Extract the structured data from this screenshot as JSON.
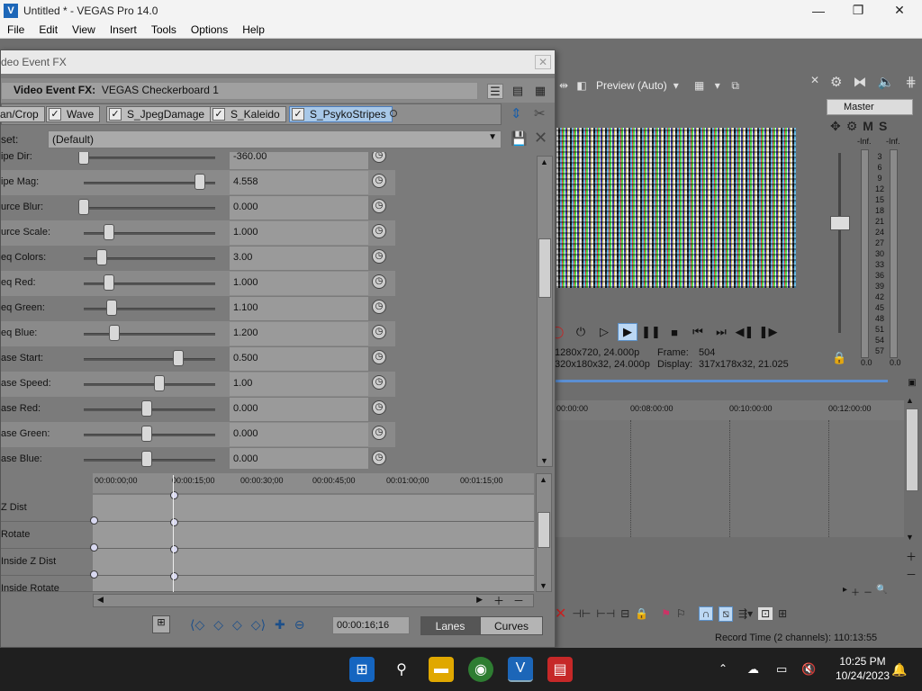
{
  "window": {
    "title": "Untitled * - VEGAS Pro 14.0",
    "logo": "V",
    "minimize": "—",
    "maximize": "❐",
    "close": "✕"
  },
  "menu": [
    "File",
    "Edit",
    "View",
    "Insert",
    "Tools",
    "Options",
    "Help"
  ],
  "fx": {
    "title": "deo Event FX",
    "header_prefix": "Video Event FX:",
    "header_name": "VEGAS Checkerboard 1",
    "chain": [
      {
        "label": "an/Crop",
        "checked": false,
        "active": false
      },
      {
        "label": "Wave",
        "checked": true,
        "active": false
      },
      {
        "label": "S_JpegDamage",
        "checked": true,
        "active": false
      },
      {
        "label": "S_Kaleido",
        "checked": true,
        "active": false
      },
      {
        "label": "S_PsykoStripes",
        "checked": true,
        "active": true
      }
    ],
    "preset_label": "set:",
    "preset_value": "(Default)",
    "params": [
      {
        "name": "ipe Dir:",
        "value": "-360.00",
        "pos": 0.0
      },
      {
        "name": "ipe Mag:",
        "value": "4.558",
        "pos": 0.92
      },
      {
        "name": "urce Blur:",
        "value": "0.000",
        "pos": 0.0
      },
      {
        "name": "urce Scale:",
        "value": "1.000",
        "pos": 0.2
      },
      {
        "name": "eq Colors:",
        "value": "3.00",
        "pos": 0.14
      },
      {
        "name": "eq Red:",
        "value": "1.000",
        "pos": 0.2
      },
      {
        "name": "eq Green:",
        "value": "1.100",
        "pos": 0.22
      },
      {
        "name": "eq Blue:",
        "value": "1.200",
        "pos": 0.24
      },
      {
        "name": "ase Start:",
        "value": "0.500",
        "pos": 0.75
      },
      {
        "name": "ase Speed:",
        "value": "1.00",
        "pos": 0.6
      },
      {
        "name": "ase Red:",
        "value": "0.000",
        "pos": 0.5
      },
      {
        "name": "ase Green:",
        "value": "0.000",
        "pos": 0.5
      },
      {
        "name": "ase Blue:",
        "value": "0.000",
        "pos": 0.5
      }
    ],
    "kf_ruler": [
      "00:00:00;00",
      "00:00:15;00",
      "00:00:30;00",
      "00:00:45;00",
      "00:01:00;00",
      "00:01:15;00"
    ],
    "kf_rows": [
      "Z Dist",
      "Rotate",
      "Inside Z Dist",
      "Inside Rotate"
    ],
    "timecode": "00:00:16;16",
    "lanes_label": "Lanes",
    "curves_label": "Curves"
  },
  "preview": {
    "mode": "Preview (Auto)",
    "project_line": "1280x720, 24.000p",
    "preview_line": "320x180x32, 24.000p",
    "frame_label": "Frame:",
    "frame_value": "504",
    "display_label": "Display:",
    "display_value": "317x178x32, 21.025"
  },
  "master": {
    "label": "Master",
    "m": "M",
    "s": "S",
    "inf_l": "-Inf.",
    "inf_r": "-Inf.",
    "scale": [
      "3",
      "6",
      "9",
      "12",
      "15",
      "18",
      "21",
      "24",
      "27",
      "30",
      "33",
      "36",
      "39",
      "42",
      "45",
      "48",
      "51",
      "54",
      "57"
    ],
    "bottom_l": "0.0",
    "bottom_r": "0.0"
  },
  "timeline": {
    "ruler": [
      "00:00:00",
      "00:08:00:00",
      "00:10:00:00",
      "00:12:00:00"
    ],
    "record_time": "Record Time (2 channels): 110:13:55"
  },
  "taskbar": {
    "time": "10:25 PM",
    "date": "10/24/2023"
  }
}
